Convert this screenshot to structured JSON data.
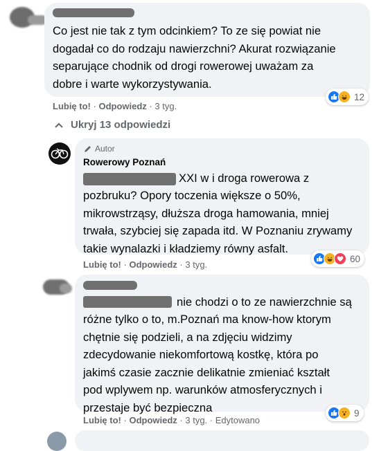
{
  "comment1": {
    "text": "Co jest nie tak z tym odcinkiem? To ze się powiat nie\ndogadał co do rodzaju nawierzchni? Akurat rozwiązanie\nseparujące chodnik od drogi rowerowej uważam za\ndobre i warte wykorzystywania.",
    "like": "Lubię to!",
    "reply": "Odpowiedz",
    "time": "3 tyg.",
    "reaction_count": "12",
    "reactions": [
      "like-icon",
      "haha-icon"
    ]
  },
  "hide_replies": "Ukryj 13 odpowiedzi",
  "reply1": {
    "badge": "Autor",
    "author": "Rowerowy Poznań",
    "first_line": "XXI w i droga rowerowa z",
    "text": "pozbruku? Opory toczenia większe o 50%,\nmikrowstrząsy, dłuższa droga hamowania, mniej\ntrwała, szybciej się zapada itd. W Poznaniu zrywamy\ntakie wynalazki i kładziemy równy asfalt.",
    "like": "Lubię to!",
    "reply": "Odpowiedz",
    "time": "3 tyg.",
    "reaction_count": "60",
    "reactions": [
      "like-icon",
      "haha-icon",
      "love-icon"
    ]
  },
  "reply2": {
    "first_line": "nie chodzi o to ze nawierzchnie są",
    "text": "różne tylko o to, m.Poznań ma know-how ktorym\nchętnie się podzieli, a na zdjęciu widzimy\nzdecydowanie niekomfortową kostkę, która po\njakimś czasie zacznie delikatnie zmieniać kształt\npod wplywem np. warunków atmosferycznych i\nprzestaje być bezpieczna",
    "like": "Lubię to!",
    "reply": "Odpowiedz",
    "time": "3 tyg.",
    "edited": "Edytowano",
    "reaction_count": "9",
    "reactions": [
      "like-icon",
      "wow-icon"
    ]
  },
  "colors": {
    "like": "#1877f2",
    "love": "#f33e58",
    "haha": "#f7b125",
    "text_secondary": "#65676b",
    "bubble": "#f0f2f5"
  }
}
